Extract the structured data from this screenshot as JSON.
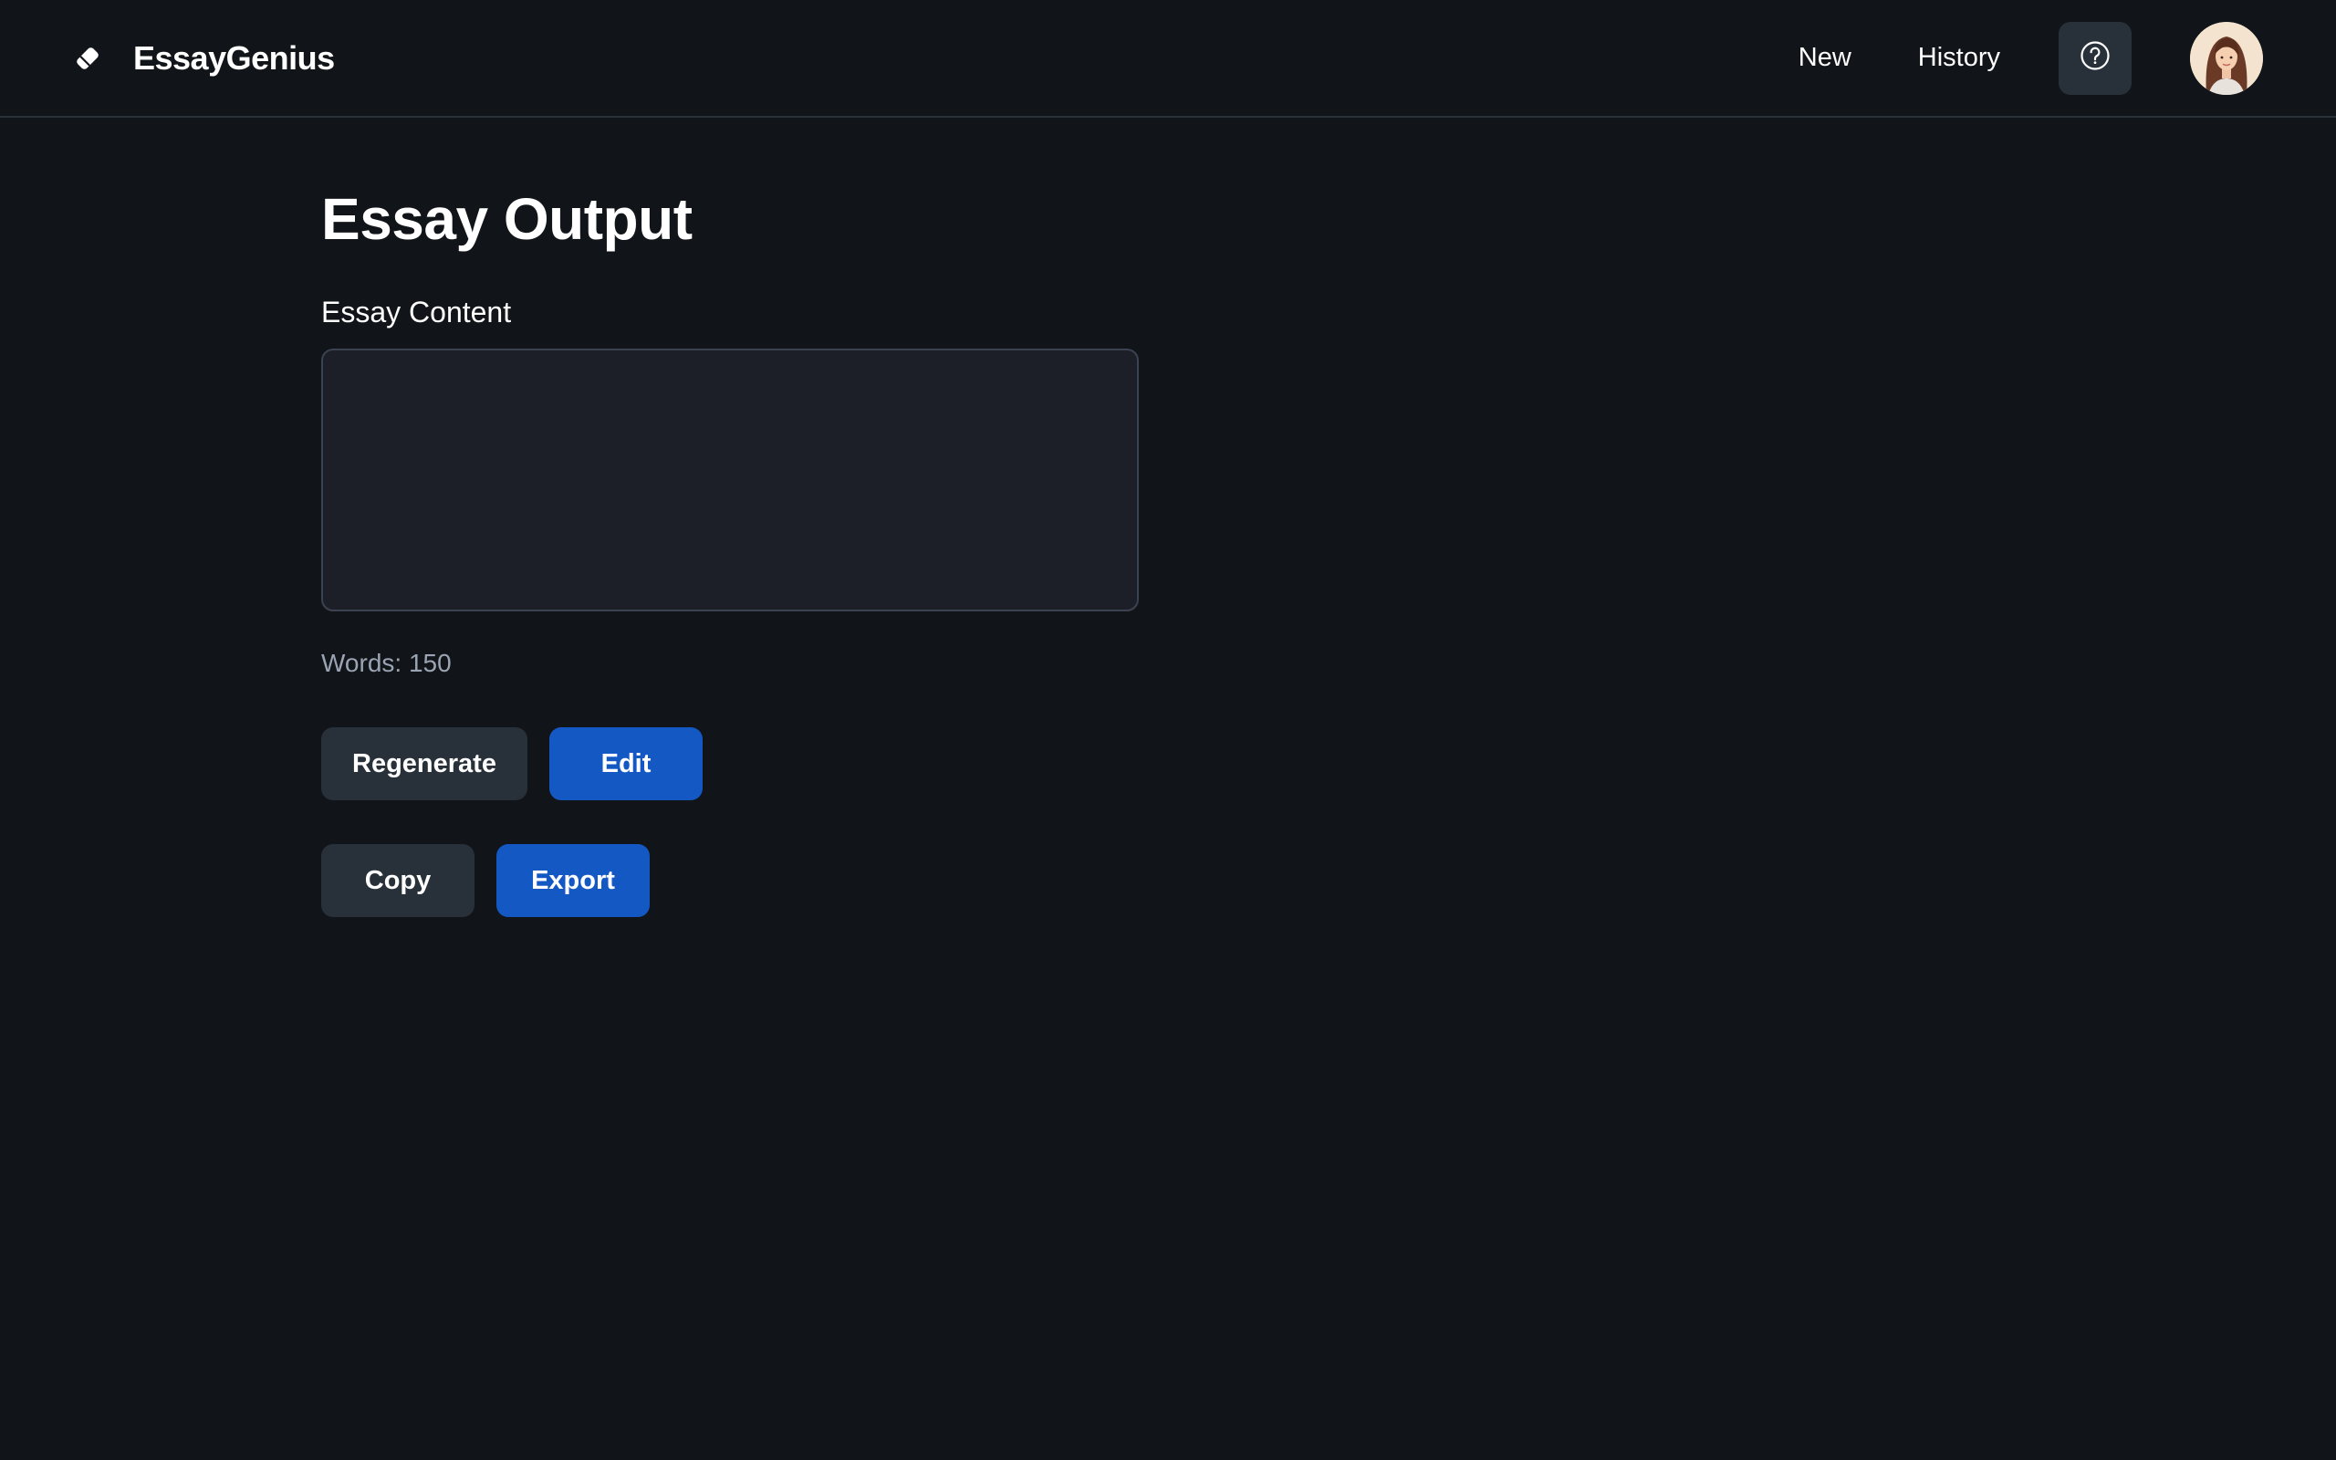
{
  "header": {
    "brand_icon": "pencil-icon",
    "brand_name": "EssayGenius",
    "nav": [
      {
        "label": "New"
      },
      {
        "label": "History"
      }
    ],
    "help_icon": "help-circle-icon"
  },
  "main": {
    "title": "Essay Output",
    "essay_label": "Essay Content",
    "essay_value": "",
    "word_count": "Words: 150",
    "buttons": {
      "regenerate": "Regenerate",
      "edit": "Edit",
      "copy": "Copy",
      "export": "Export"
    }
  },
  "colors": {
    "background": "#111418",
    "surface": "#1c1f27",
    "secondary_button": "#283039",
    "primary_button": "#1458c4",
    "muted_text": "#9aa4b2"
  }
}
